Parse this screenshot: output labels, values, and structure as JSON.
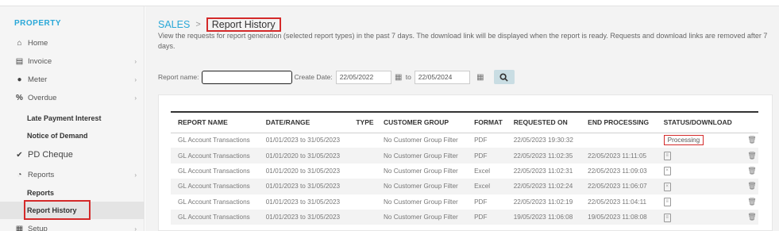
{
  "sidebar": {
    "heading": "PROPERTY",
    "items": [
      {
        "label": "Home",
        "icon": "home-icon"
      },
      {
        "label": "Invoice",
        "icon": "invoice-icon"
      },
      {
        "label": "Meter",
        "icon": "meter-icon"
      },
      {
        "label": "Overdue",
        "icon": "percent-icon"
      },
      {
        "label": "Late Payment Interest"
      },
      {
        "label": "Notice of Demand"
      },
      {
        "label": "PD Cheque",
        "icon": "check-icon"
      },
      {
        "label": "Reports",
        "icon": "pie-chart-icon"
      },
      {
        "label": "Reports"
      },
      {
        "label": "Report History"
      },
      {
        "label": "Setup",
        "icon": "grid-icon"
      }
    ]
  },
  "breadcrumb": {
    "parent": "SALES",
    "current": "Report History"
  },
  "description": "View the requests for report generation (selected report types) in the past 7 days. The download link will be displayed when the report is ready. Requests and download links are removed after 7 days.",
  "filter": {
    "report_name_label": "Report name:",
    "report_name_value": "",
    "create_date_label": "Create Date:",
    "date_from": "22/05/2022",
    "to_label": "to",
    "date_to": "22/05/2024"
  },
  "table": {
    "headers": [
      "REPORT NAME",
      "DATE/RANGE",
      "TYPE",
      "CUSTOMER GROUP",
      "FORMAT",
      "REQUESTED ON",
      "END PROCESSING",
      "STATUS/DOWNLOAD"
    ],
    "rows": [
      {
        "name": "GL Account Transactions",
        "range": "01/01/2023 to 31/05/2023",
        "type": "",
        "group": "No Customer Group Filter",
        "format": "PDF",
        "requested": "22/05/2023 19:30:32",
        "end": "",
        "status": "Processing"
      },
      {
        "name": "GL Account Transactions",
        "range": "01/01/2020 to 31/05/2023",
        "type": "",
        "group": "No Customer Group Filter",
        "format": "PDF",
        "requested": "22/05/2023 11:02:35",
        "end": "22/05/2023 11:11:05",
        "status": ""
      },
      {
        "name": "GL Account Transactions",
        "range": "01/01/2020 to 31/05/2023",
        "type": "",
        "group": "No Customer Group Filter",
        "format": "Excel",
        "requested": "22/05/2023 11:02:31",
        "end": "22/05/2023 11:09:03",
        "status": ""
      },
      {
        "name": "GL Account Transactions",
        "range": "01/01/2023 to 31/05/2023",
        "type": "",
        "group": "No Customer Group Filter",
        "format": "Excel",
        "requested": "22/05/2023 11:02:24",
        "end": "22/05/2023 11:06:07",
        "status": ""
      },
      {
        "name": "GL Account Transactions",
        "range": "01/01/2023 to 31/05/2023",
        "type": "",
        "group": "No Customer Group Filter",
        "format": "PDF",
        "requested": "22/05/2023 11:02:19",
        "end": "22/05/2023 11:04:11",
        "status": ""
      },
      {
        "name": "GL Account Transactions",
        "range": "01/01/2023 to 31/05/2023",
        "type": "",
        "group": "No Customer Group Filter",
        "format": "PDF",
        "requested": "19/05/2023 11:06:08",
        "end": "19/05/2023 11:08:08",
        "status": ""
      }
    ]
  },
  "colors": {
    "accent": "#2aa8d8",
    "highlight": "#d42a2a"
  }
}
